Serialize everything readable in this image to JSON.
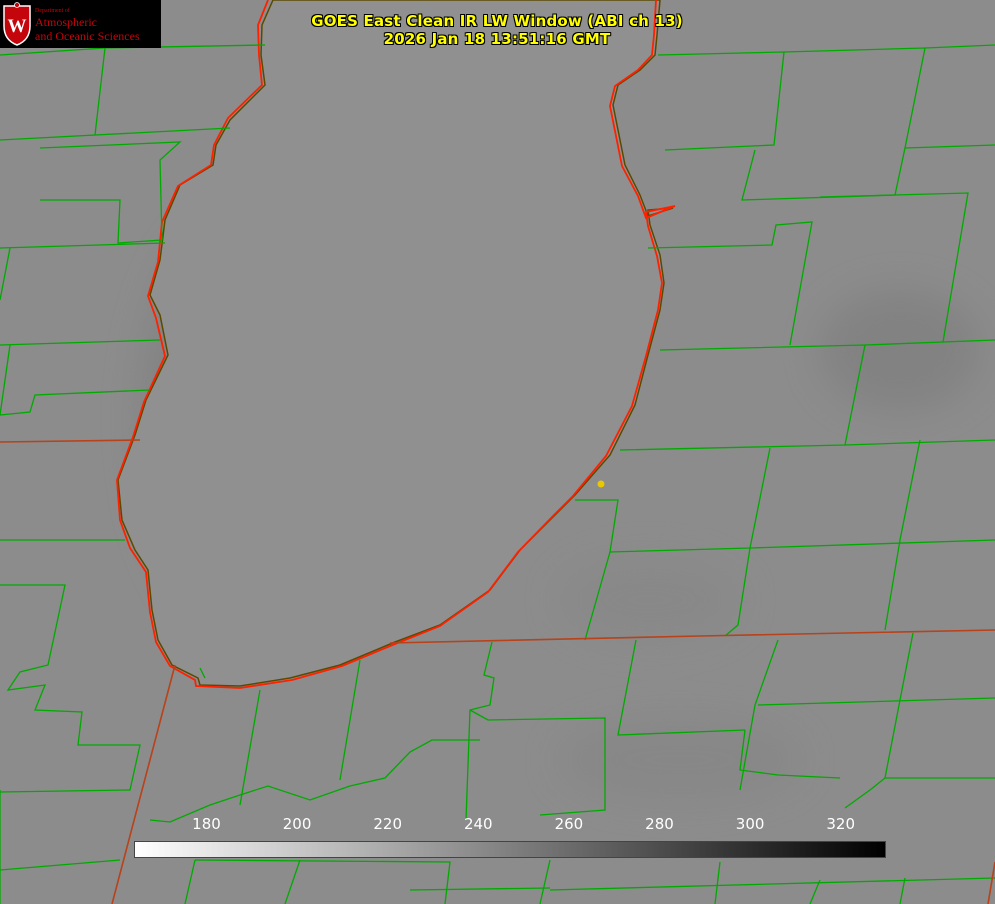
{
  "logo": {
    "department": "Department of",
    "line1": "Atmospheric",
    "line2": "and Oceanic Sciences",
    "crest_letter": "W",
    "icon": "uw-crest-icon",
    "color": "#c5050c"
  },
  "title": {
    "line1": "GOES East Clean IR LW Window (ABI ch 13)",
    "line2": "2026 Jan 18 13:51:16 GMT",
    "color": "#ffff00"
  },
  "colorbar": {
    "ticks": [
      "180",
      "200",
      "220",
      "240",
      "260",
      "280",
      "300",
      "320"
    ],
    "range": [
      164,
      330
    ],
    "gradient": [
      "#ffffff",
      "#000000"
    ]
  },
  "map": {
    "state_border_color": "#b8421a",
    "county_line_color": "#00aa00",
    "lake_outline_color": "#ff0000",
    "marker_color": "#e8c800"
  }
}
